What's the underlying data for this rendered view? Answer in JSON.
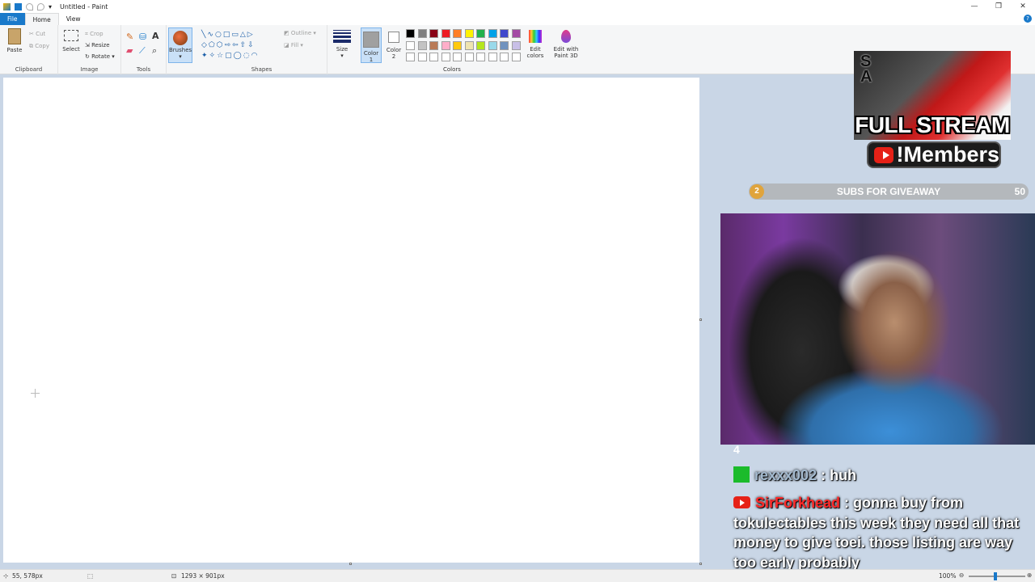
{
  "window": {
    "title": "Untitled - Paint",
    "controls": {
      "minimize": "—",
      "restore": "❐",
      "close": "✕"
    }
  },
  "ribbon_tabs": [
    "File",
    "Home",
    "View"
  ],
  "help_label": "?",
  "ribbon": {
    "clipboard": {
      "label": "Clipboard",
      "paste": "Paste",
      "cut": "Cut",
      "copy": "Copy"
    },
    "image": {
      "label": "Image",
      "select": "Select",
      "crop": "Crop",
      "resize": "Resize",
      "rotate": "Rotate"
    },
    "tools": {
      "label": "Tools"
    },
    "brushes": {
      "label": "Brushes"
    },
    "shapes": {
      "label": "Shapes",
      "outline": "Outline",
      "fill": "Fill"
    },
    "size": {
      "label": "Size"
    },
    "colors": {
      "label": "Colors",
      "color1": "Color 1",
      "color2": "Color 2",
      "edit_colors": "Edit colors",
      "edit_paint3d": "Edit with Paint 3D",
      "row1": [
        "#000000",
        "#7f7f7f",
        "#880015",
        "#ed1c24",
        "#ff7f27",
        "#fff200",
        "#22b14c",
        "#00a2e8",
        "#3f48cc",
        "#a349a4"
      ],
      "row2": [
        "#ffffff",
        "#c3c3c3",
        "#b97a57",
        "#ffaec9",
        "#ffc90e",
        "#efe4b0",
        "#b5e61d",
        "#99d9ea",
        "#7092be",
        "#c8bfe7"
      ],
      "row3": [
        "#ffffff",
        "#ffffff",
        "#ffffff",
        "#ffffff",
        "#ffffff",
        "#ffffff",
        "#ffffff",
        "#ffffff",
        "#ffffff",
        "#ffffff"
      ]
    }
  },
  "status_bar": {
    "cursor_position": "55, 578px",
    "canvas_size": "1293 × 901px",
    "zoom": "100%"
  },
  "overlay": {
    "promo_letters": "S\nA",
    "promo_title": "FULL STREAM",
    "promo_members": "!Members",
    "subs_goal": {
      "current": "2",
      "label": "SUBS FOR GIVEAWAY",
      "goal": "50"
    },
    "chat": {
      "previous_fragment": "4",
      "messages": [
        {
          "user": "rexxx002",
          "text": ": huh"
        },
        {
          "user": "SirForkhead",
          "text": ": gonna buy from tokulectables this week they need all that money to give toei. those listing are way too early probably"
        }
      ]
    }
  }
}
